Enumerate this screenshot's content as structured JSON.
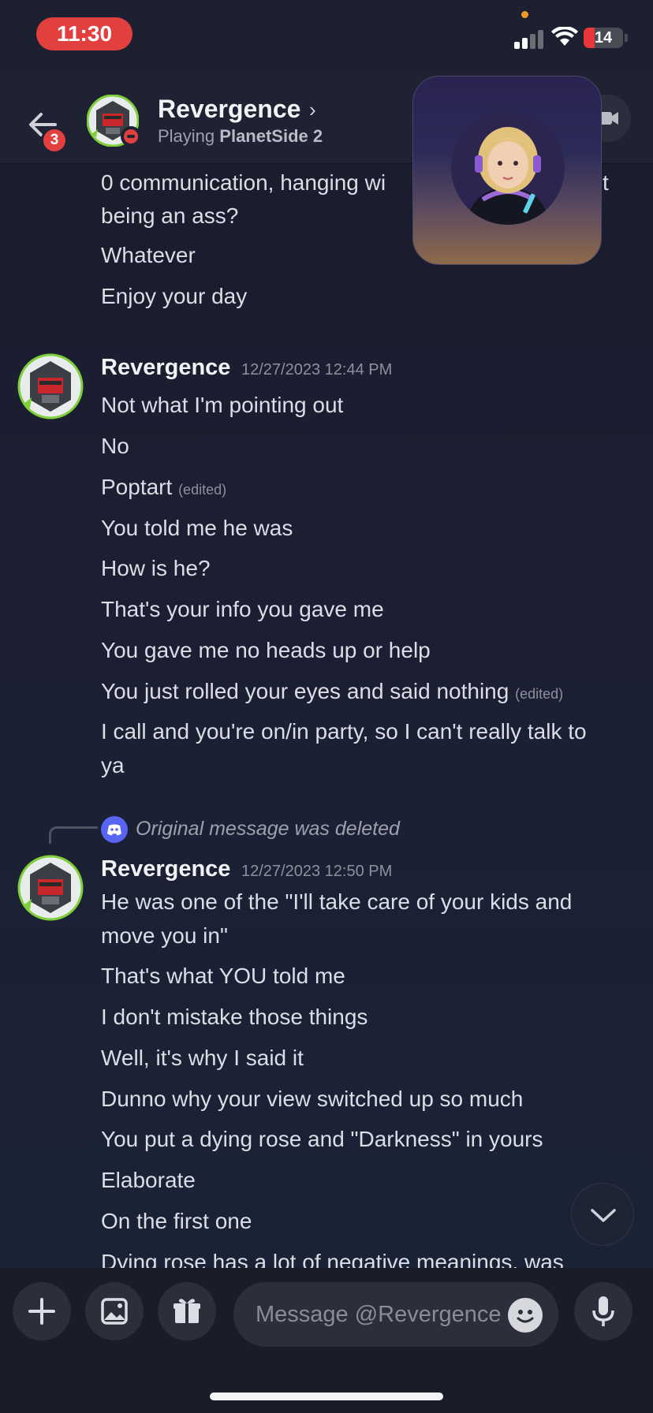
{
  "status_bar": {
    "time": "11:30",
    "battery": "14"
  },
  "header": {
    "back_badge": "3",
    "name": "Revergence",
    "activity_prefix": "Playing",
    "activity_game": "PlanetSide 2"
  },
  "messages": {
    "group0": {
      "lines": [
        "0 communication, hanging wi",
        "being an ass?",
        "Whatever",
        "Enjoy your day"
      ],
      "line0_tail": "t"
    },
    "group1": {
      "author": "Revergence",
      "timestamp": "12/27/2023 12:44 PM",
      "lines": [
        "Not what I'm pointing out",
        "No",
        "Poptart",
        "You told me he was",
        "How is he?",
        "That's your info you gave me",
        "You gave me no heads up or help",
        "You just rolled your eyes and said nothing",
        "I call and you're on/in party, so I can't really talk to",
        "ya"
      ],
      "edited_label": "(edited)"
    },
    "reply": {
      "text": "Original message was deleted"
    },
    "group2": {
      "author": "Revergence",
      "timestamp": "12/27/2023 12:50 PM",
      "lines": [
        "He was one of the \"I'll take care of your kids and",
        "move you in\"",
        "That's what YOU told me",
        "I don't mistake those things",
        "Well, it's why I said it",
        "Dunno why your view switched up so much",
        "You put a dying rose and \"Darkness\" in yours",
        "Elaborate",
        "On the first one",
        "Dying rose has a lot of negative meanings, was"
      ]
    }
  },
  "composer": {
    "placeholder": "Message @Revergence"
  },
  "colors": {
    "accent": "#5865f2",
    "danger": "#e2403e",
    "background": "#1c1f33"
  }
}
